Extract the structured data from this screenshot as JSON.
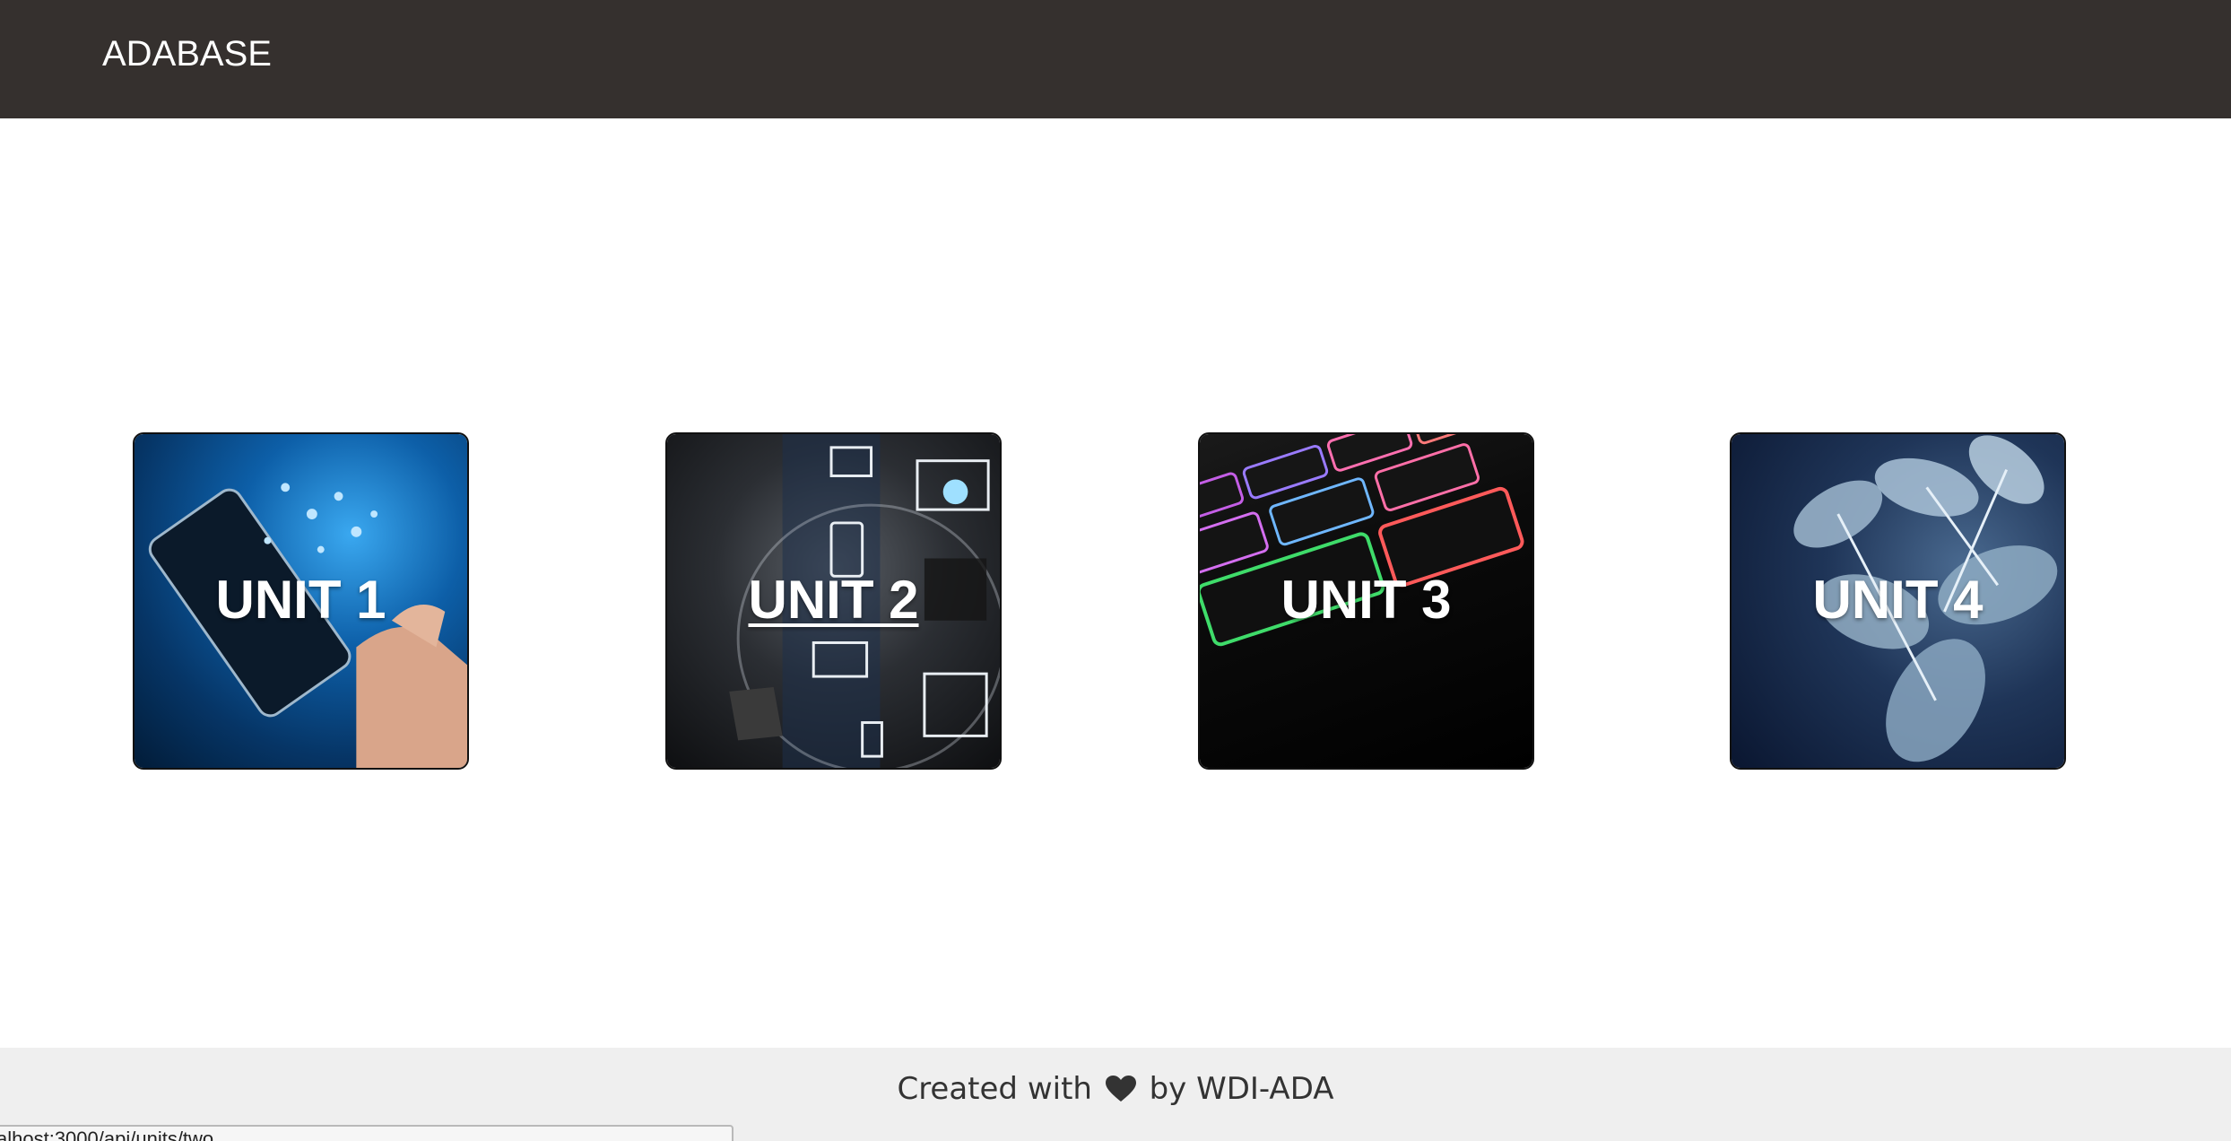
{
  "header": {
    "brand": "ADABASE"
  },
  "units": [
    {
      "label": "UNIT 1",
      "icon": "smartphone-apps-image"
    },
    {
      "label": "UNIT 2",
      "icon": "tech-network-devices-image"
    },
    {
      "label": "UNIT 3",
      "icon": "backlit-keyboard-image"
    },
    {
      "label": "UNIT 4",
      "icon": "frosted-leaves-image"
    }
  ],
  "footer": {
    "prefix": "Created with",
    "heart_icon": "heart-icon",
    "suffix": "by WDI-ADA"
  },
  "status": {
    "url": "alhost:3000/api/units/two"
  },
  "colors": {
    "header_bg": "#35302e",
    "footer_bg": "#efefef",
    "text_dark": "#333333"
  }
}
